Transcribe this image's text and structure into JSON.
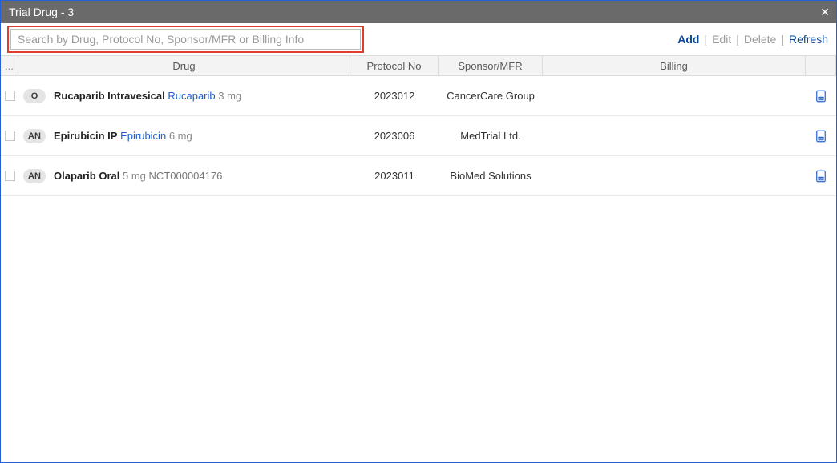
{
  "titlebar": {
    "title": "Trial Drug - 3",
    "close": "✕"
  },
  "search": {
    "placeholder": "Search by Drug, Protocol No, Sponsor/MFR or Billing Info"
  },
  "actions": {
    "add": "Add",
    "edit": "Edit",
    "delete": "Delete",
    "refresh": "Refresh",
    "sep": "|"
  },
  "headers": {
    "dots": "...",
    "drug": "Drug",
    "proto": "Protocol No",
    "sponsor": "Sponsor/MFR",
    "billing": "Billing"
  },
  "rows": [
    {
      "badge": "O",
      "name": "Rucaparib Intravesical",
      "link": "Rucaparib",
      "dose": "3 mg",
      "nct": "",
      "proto": "2023012",
      "sponsor": "CancerCare Group",
      "billing": ""
    },
    {
      "badge": "AN",
      "name": "Epirubicin IP",
      "link": "Epirubicin",
      "dose": "6 mg",
      "nct": "",
      "proto": "2023006",
      "sponsor": "MedTrial Ltd.",
      "billing": ""
    },
    {
      "badge": "AN",
      "name": "Olaparib Oral",
      "link": "",
      "dose": "5 mg",
      "nct": "NCT000004176",
      "proto": "2023011",
      "sponsor": "BioMed Solutions",
      "billing": ""
    }
  ]
}
